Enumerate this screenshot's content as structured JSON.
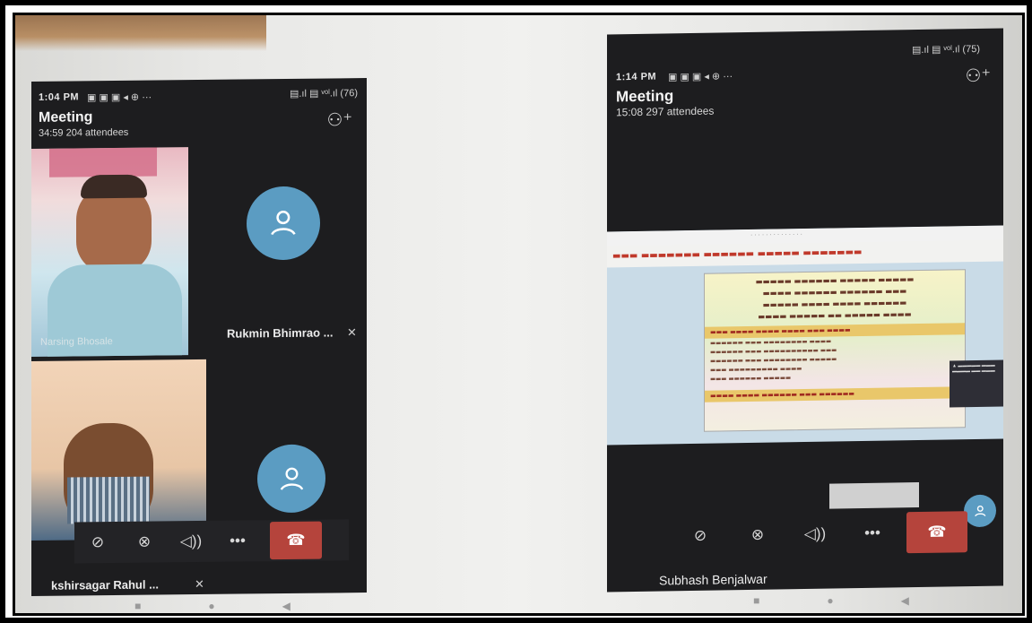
{
  "phone_left": {
    "status_time": "1:04 PM",
    "status_icons": "▣ ▣ ▣ ◂ ⊕ ···",
    "signal_icons": "▤.ıl ▤ ᵛᵒˡ.ıl (76)",
    "meeting_title": "Meeting",
    "meeting_info": "34:59  204 attendees",
    "tile_video_name": "Narsing Bhosale",
    "tile_right_name": "Rukmin Bhimrao ...",
    "tile_bottom_name": "kshirsagar Rahul ...",
    "controls": [
      "camera-off",
      "mic-off",
      "speaker",
      "more",
      "hang-up"
    ],
    "nav": [
      "■",
      "●",
      "◀"
    ]
  },
  "phone_right": {
    "status_time": "1:14 PM",
    "status_icons": "▣ ▣ ▣ ◂ ⊕ ···",
    "signal_icons": "▤.ıl ▤ ᵛᵒˡ.ıl (75)",
    "meeting_title": "Meeting",
    "meeting_info": "15:08  297 attendees",
    "presenter_name": "Subhash Benjalwar",
    "controls": [
      "camera-off",
      "mic-off",
      "speaker",
      "more",
      "hang-up"
    ],
    "nav": [
      "■",
      "●",
      "◀"
    ]
  },
  "icons": {
    "people": "⚇⁺",
    "camera_off": "⊘",
    "mic_off": "🎙̸",
    "speaker": "◁))",
    "more": "•••",
    "hang_up": "☎"
  },
  "colors": {
    "phone_bg": "#1d1d1f",
    "avatar": "#5b9cc2",
    "hang_up": "#b5443c"
  }
}
